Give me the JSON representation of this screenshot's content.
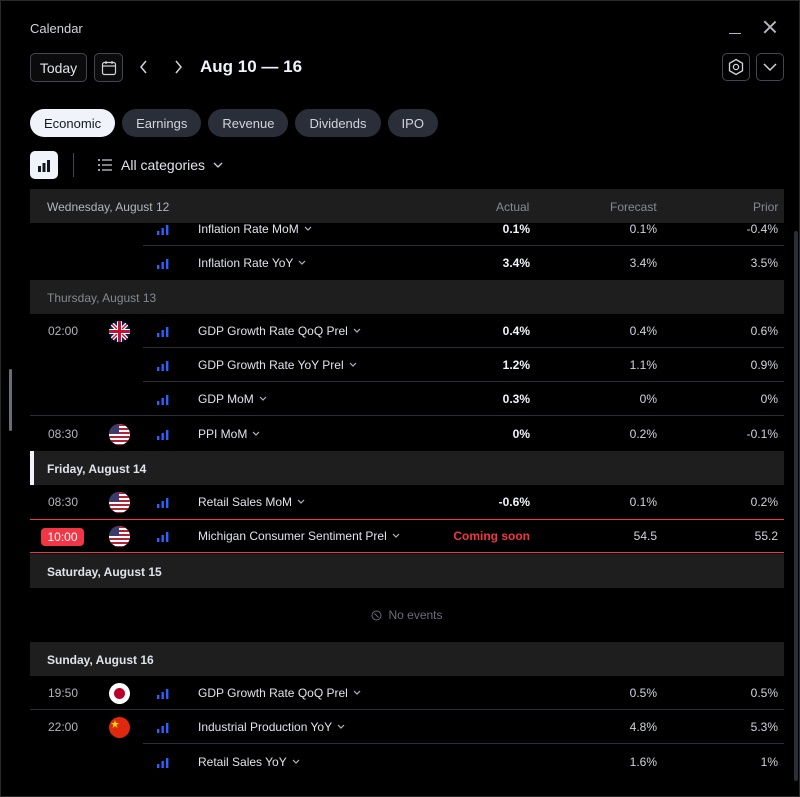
{
  "window": {
    "title": "Calendar"
  },
  "toolbar": {
    "today_label": "Today",
    "date_range": "Aug 10 — 16"
  },
  "tabs": [
    {
      "label": "Economic",
      "active": true
    },
    {
      "label": "Earnings",
      "active": false
    },
    {
      "label": "Revenue",
      "active": false
    },
    {
      "label": "Dividends",
      "active": false
    },
    {
      "label": "IPO",
      "active": false
    }
  ],
  "filter": {
    "category_label": "All categories"
  },
  "table": {
    "header": {
      "day": "Wednesday, August 12",
      "actual": "Actual",
      "forecast": "Forecast",
      "prior": "Prior"
    }
  },
  "wed": {
    "events": [
      {
        "name": "Inflation Rate MoM",
        "actual": "0.1%",
        "forecast": "0.1%",
        "prior": "-0.4%"
      },
      {
        "name": "Inflation Rate YoY",
        "actual": "3.4%",
        "forecast": "3.4%",
        "prior": "3.5%"
      }
    ]
  },
  "thu": {
    "day": "Thursday, August 13",
    "events": [
      {
        "time": "02:00",
        "country": "GB",
        "name": "GDP Growth Rate QoQ Prel",
        "actual": "0.4%",
        "forecast": "0.4%",
        "prior": "0.6%"
      },
      {
        "name": "GDP Growth Rate YoY Prel",
        "actual": "1.2%",
        "forecast": "1.1%",
        "prior": "0.9%"
      },
      {
        "name": "GDP MoM",
        "actual": "0.3%",
        "forecast": "0%",
        "prior": "0%"
      },
      {
        "time": "08:30",
        "country": "US",
        "name": "PPI MoM",
        "actual": "0%",
        "forecast": "0.2%",
        "prior": "-0.1%"
      }
    ]
  },
  "fri": {
    "day": "Friday, August 14",
    "events": [
      {
        "time": "08:30",
        "country": "US",
        "name": "Retail Sales MoM",
        "actual": "-0.6%",
        "forecast": "0.1%",
        "prior": "0.2%"
      },
      {
        "time": "10:00",
        "country": "US",
        "name": "Michigan Consumer Sentiment Prel",
        "actual": "Coming soon",
        "forecast": "54.5",
        "prior": "55.2"
      }
    ]
  },
  "sat": {
    "day": "Saturday, August 15",
    "empty_text": "No events"
  },
  "sun": {
    "day": "Sunday, August 16",
    "events": [
      {
        "time": "19:50",
        "country": "JP",
        "name": "GDP Growth Rate QoQ Prel",
        "actual": "",
        "forecast": "0.5%",
        "prior": "0.5%"
      },
      {
        "time": "22:00",
        "country": "CN",
        "name": "Industrial Production YoY",
        "actual": "",
        "forecast": "4.8%",
        "prior": "5.3%"
      },
      {
        "name": "Retail Sales YoY",
        "actual": "",
        "forecast": "1.6%",
        "prior": "1%"
      }
    ]
  },
  "colors": {
    "accent_red": "#f23645",
    "importance_blue": "#2962ff"
  },
  "icons": [
    "calendar-icon",
    "chevron-left-icon",
    "chevron-right-icon",
    "settings-icon",
    "chevron-down-icon",
    "bar-chart-icon",
    "list-icon",
    "info-icon",
    "flag-gb-icon",
    "flag-us-icon",
    "flag-jp-icon",
    "flag-cn-icon",
    "importance-icon"
  ]
}
